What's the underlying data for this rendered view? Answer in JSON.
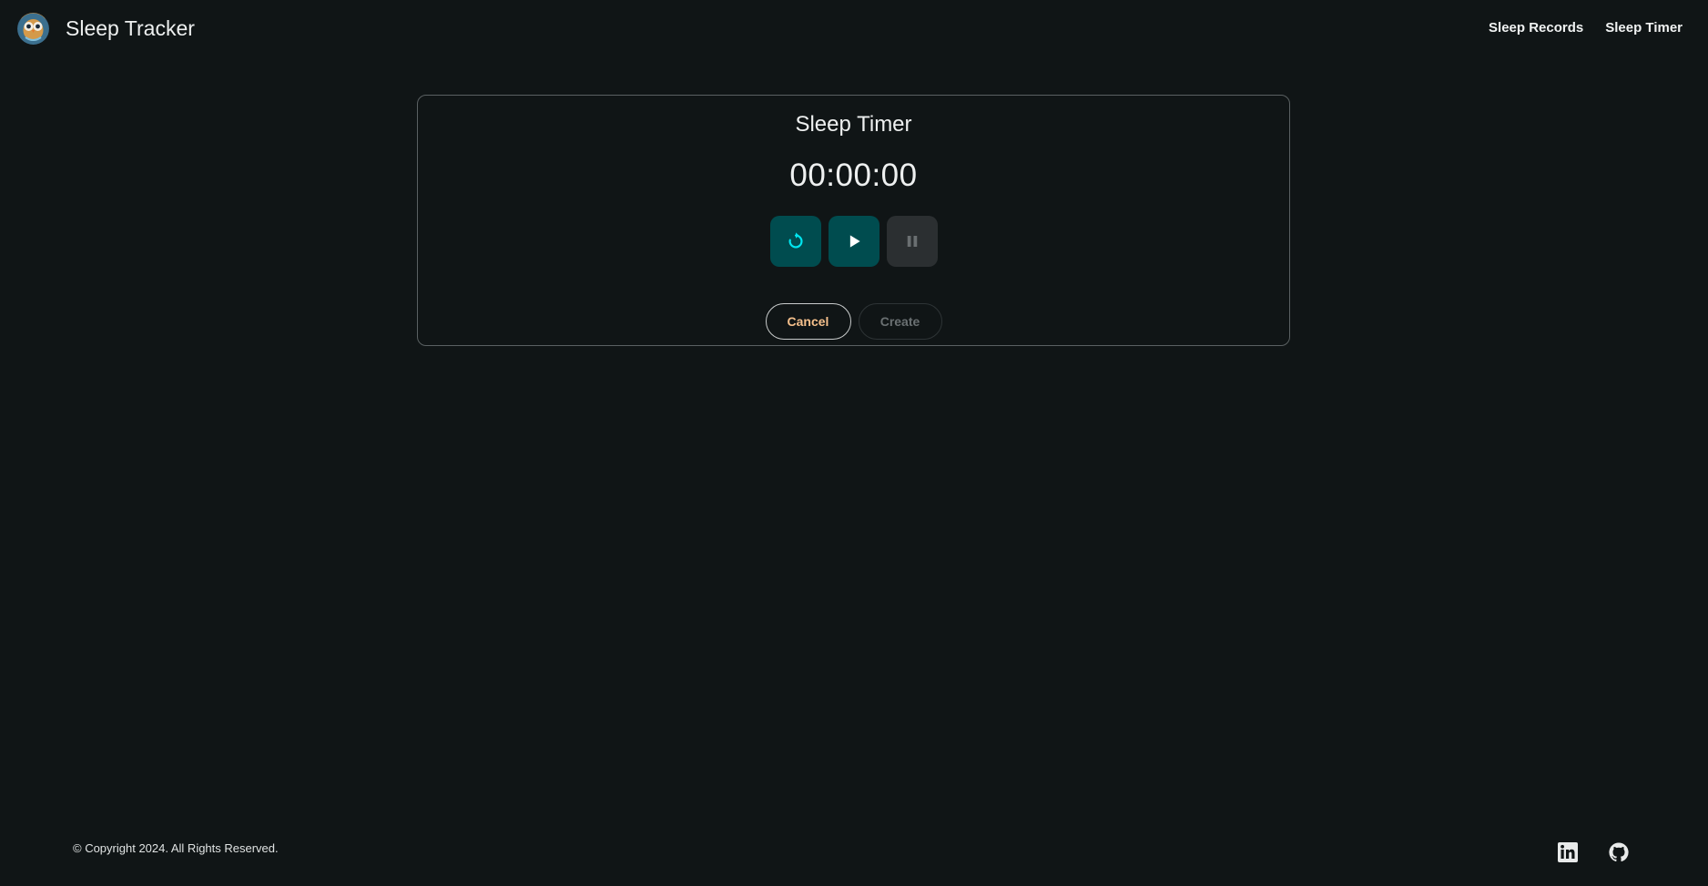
{
  "header": {
    "app_title": "Sleep Tracker",
    "logo_icon": "owl-logo-icon",
    "nav": [
      {
        "label": "Sleep Records"
      },
      {
        "label": "Sleep Timer"
      }
    ]
  },
  "card": {
    "title": "Sleep Timer",
    "timer_value": "00:00:00",
    "controls": [
      {
        "icon": "reset-icon",
        "enabled": true
      },
      {
        "icon": "play-icon",
        "enabled": true
      },
      {
        "icon": "pause-icon",
        "enabled": false
      }
    ],
    "cancel_label": "Cancel",
    "create_label": "Create"
  },
  "footer": {
    "copyright": "© Copyright 2024. All Rights Reserved.",
    "social": [
      {
        "icon": "linkedin-icon"
      },
      {
        "icon": "github-icon"
      }
    ]
  },
  "colors": {
    "background": "#101516",
    "accent": "#004c4f",
    "accent_icon": "#00e5ef",
    "cancel_text": "#f5c08c"
  }
}
